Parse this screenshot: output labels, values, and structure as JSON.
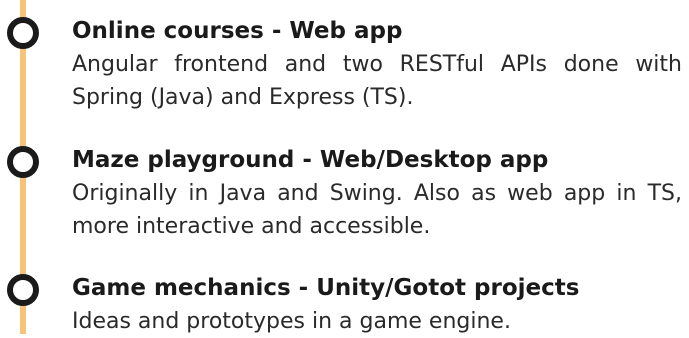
{
  "timeline": {
    "line_color": "#f7c27a",
    "marker_color": "#1a1a1a",
    "items": [
      {
        "marker_icon": "circle-ring-icon",
        "title": "Online courses - Web app",
        "description": "Angular frontend and two RESTful APIs done with Spring (Java) and Express (TS)."
      },
      {
        "marker_icon": "circle-ring-icon",
        "title": "Maze playground - Web/Desktop app",
        "description": "Originally in Java and Swing. Also as web app in TS, more interactive and accessible."
      },
      {
        "marker_icon": "circle-ring-icon",
        "title": "Game mechanics - Unity/Gotot projects",
        "description": "Ideas and prototypes in a game engine."
      }
    ]
  }
}
